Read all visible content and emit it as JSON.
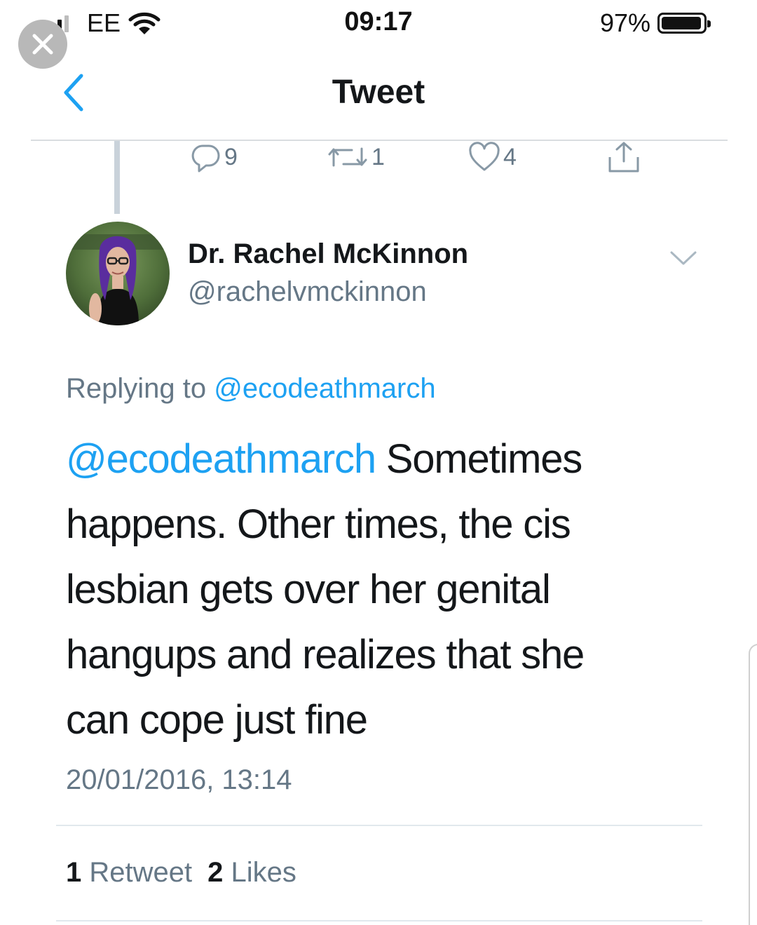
{
  "status_bar": {
    "carrier": "EE",
    "time": "09:17",
    "battery_percent": "97%",
    "battery_level": 0.97,
    "signal_bars_filled": 3,
    "signal_bars_total": 4
  },
  "nav": {
    "title": "Tweet"
  },
  "previous_tweet_actions": {
    "reply_count": "9",
    "retweet_count": "1",
    "like_count": "4"
  },
  "author": {
    "name": "Dr. Rachel McKinnon",
    "handle": "@rachelvmckinnon"
  },
  "tweet": {
    "replying_prefix": "Replying to",
    "replying_to": "@ecodeathmarch",
    "mention": "@ecodeathmarch",
    "lines": [
      " Sometimes",
      "happens. Other times, the cis",
      "lesbian gets over her genital",
      "hangups and realizes that she",
      "can cope just fine"
    ],
    "timestamp": "20/01/2016, 13:14"
  },
  "stats": {
    "retweet_count": "1",
    "retweet_label": "Retweet",
    "like_count": "2",
    "like_label": "Likes"
  },
  "colors": {
    "link_blue": "#1da1f2",
    "secondary_text": "#657786",
    "primary_text": "#14171a"
  },
  "icons": {
    "close": "close-icon",
    "back": "chevron-left-icon",
    "reply": "reply-icon",
    "retweet": "retweet-icon",
    "like": "heart-icon",
    "share": "share-icon",
    "caret": "chevron-down-icon",
    "wifi": "wifi-icon",
    "signal": "signal-icon",
    "battery": "battery-icon"
  }
}
